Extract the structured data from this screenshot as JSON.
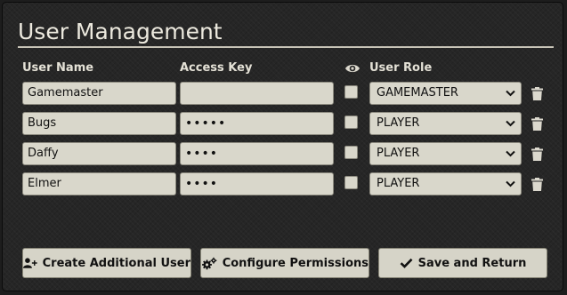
{
  "dialog": {
    "title": "User Management"
  },
  "table": {
    "headers": {
      "user_name": "User Name",
      "access_key": "Access Key",
      "user_role": "User Role"
    },
    "rows": [
      {
        "user_name": "Gamemaster",
        "access_key": "",
        "show_key": false,
        "role": "GAMEMASTER"
      },
      {
        "user_name": "Bugs",
        "access_key": "•••••",
        "show_key": false,
        "role": "PLAYER"
      },
      {
        "user_name": "Daffy",
        "access_key": "••••",
        "show_key": false,
        "role": "PLAYER"
      },
      {
        "user_name": "Elmer",
        "access_key": "••••",
        "show_key": false,
        "role": "PLAYER"
      }
    ]
  },
  "buttons": {
    "create": "Create Additional User",
    "configure": "Configure Permissions",
    "save": "Save and Return"
  },
  "icons": {
    "eye": "eye-icon",
    "trash": "trash-icon",
    "chevron": "chevron-down-icon",
    "user_plus": "user-plus-icon",
    "cogs": "cogs-icon",
    "check": "check-icon"
  }
}
